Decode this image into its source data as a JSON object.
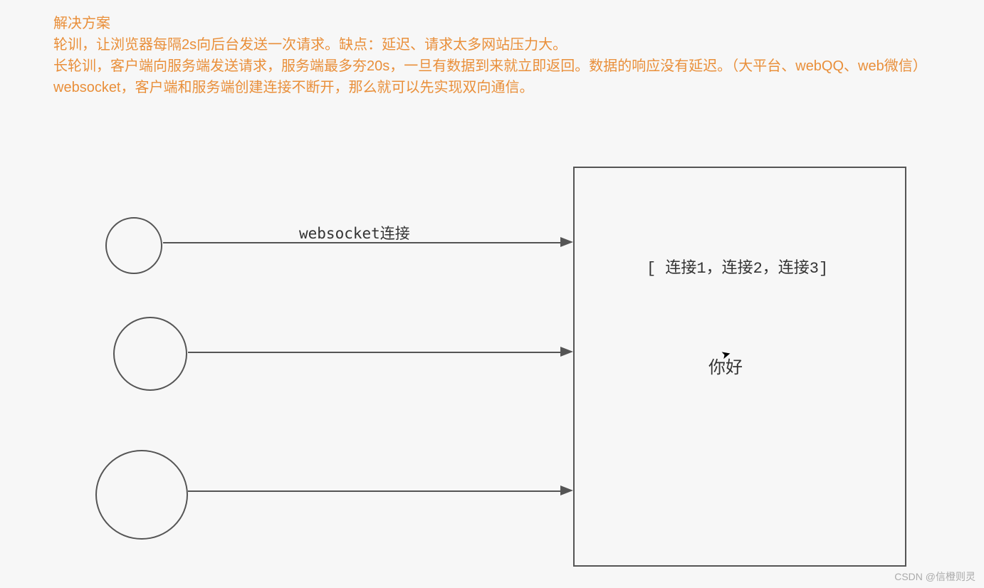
{
  "header": {
    "title": "解决方案",
    "line1": "轮训，让浏览器每隔2s向后台发送一次请求。缺点：延迟、请求太多网站压力大。",
    "line2": "长轮训，客户端向服务端发送请求，服务端最多夯20s，一旦有数据到来就立即返回。数据的响应没有延迟。（大平台、webQQ、web微信）",
    "line3": "websocket，客户端和服务端创建连接不断开，那么就可以先实现双向通信。"
  },
  "diagram": {
    "arrow_label": "websocket连接",
    "server_conn_list": "[ 连接1，连接2，连接3]",
    "server_message": "你好"
  },
  "watermark": "CSDN @信橙则灵"
}
